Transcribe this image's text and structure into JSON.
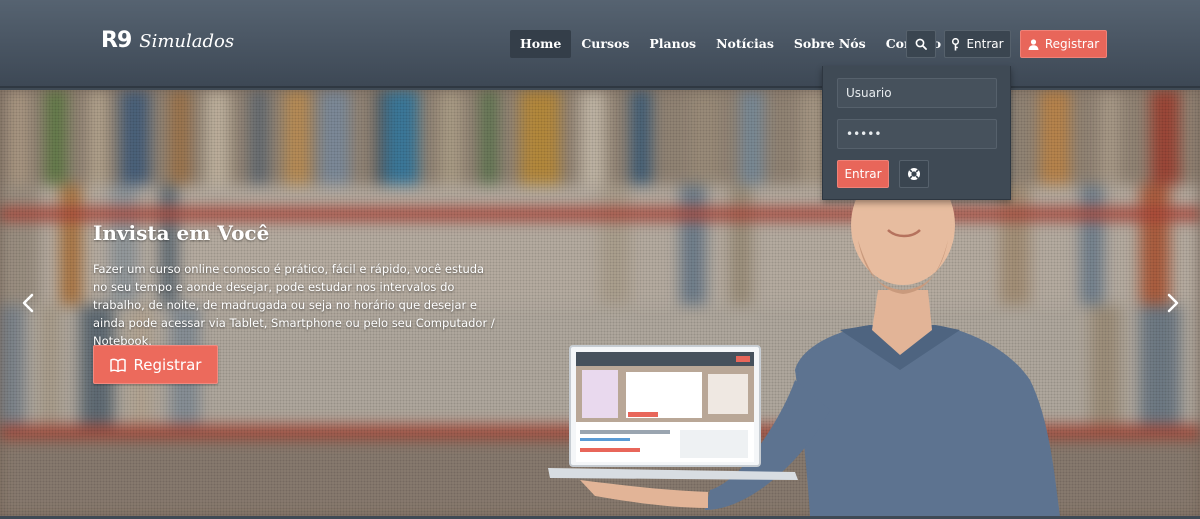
{
  "brand": {
    "mark": "R9",
    "name": "Simulados"
  },
  "nav": {
    "items": [
      {
        "label": "Home",
        "active": true
      },
      {
        "label": "Cursos"
      },
      {
        "label": "Planos"
      },
      {
        "label": "Notícias"
      },
      {
        "label": "Sobre Nós"
      },
      {
        "label": "Contato"
      }
    ],
    "search_icon": "search-icon",
    "login_label": "Entrar",
    "register_label": "Registrar"
  },
  "login": {
    "username_value": "Usuario",
    "password_value": "•••••",
    "submit_label": "Entrar",
    "help_icon": "lifebuoy-icon"
  },
  "hero": {
    "title": "Invista em Você",
    "text": "Fazer um curso online conosco é prático, fácil e rápido, você estuda no seu tempo e aonde desejar, pode estudar nos intervalos do trabalho, de noite, de madrugada ou seja no horário que desejar e ainda pode acessar via Tablet, Smartphone ou pelo seu Computador / Notebook.",
    "cta_label": "Registrar",
    "cta_icon": "book-icon"
  },
  "colors": {
    "header": "#4a5563",
    "accent": "#e8665a",
    "active_nav": "#343e49"
  }
}
